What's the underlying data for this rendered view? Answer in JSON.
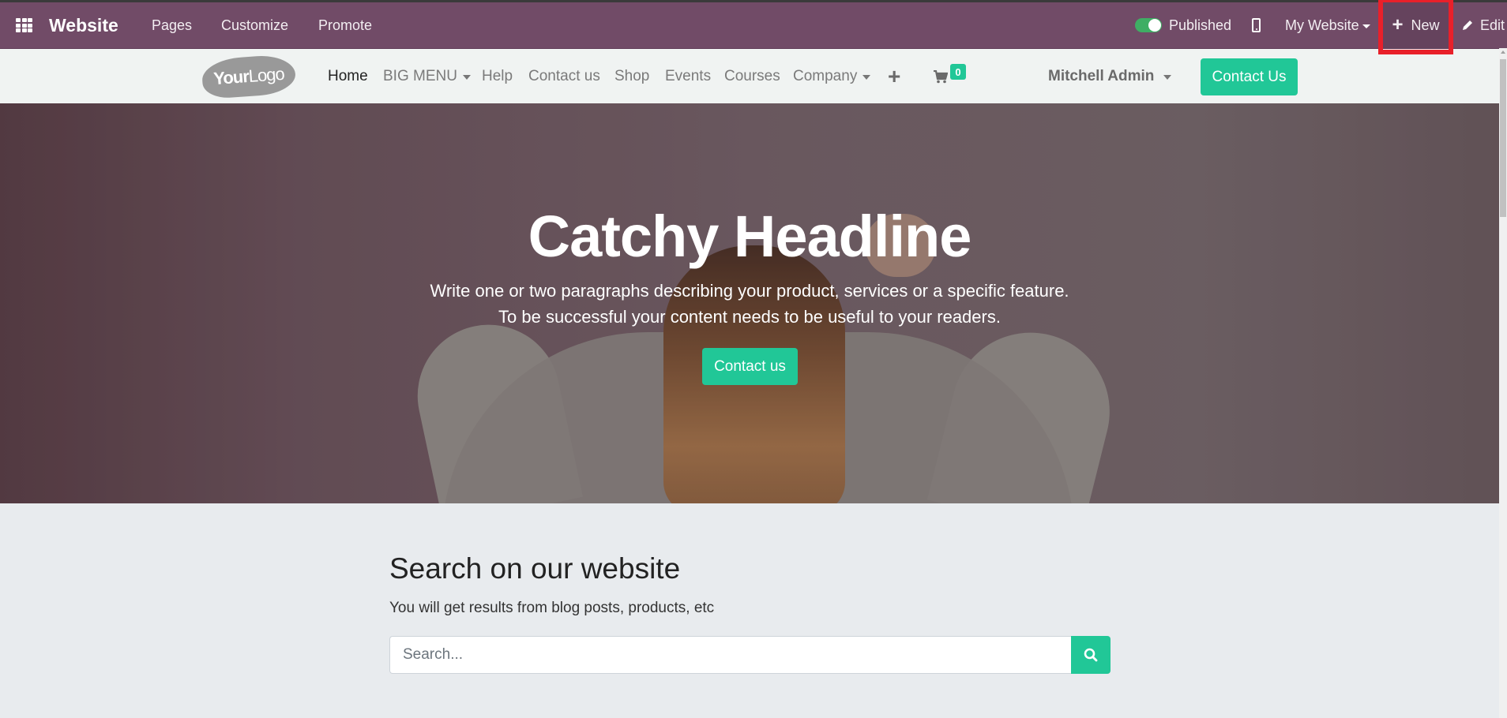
{
  "topbar": {
    "app_icon": "grid-icon",
    "app_name": "Website",
    "menu": [
      "Pages",
      "Customize",
      "Promote"
    ],
    "published_label": "Published",
    "published": true,
    "mobile_preview_icon": "phone-icon",
    "website_selector": "My Website",
    "new_label": "New",
    "edit_label": "Edit",
    "highlight_color": "#e8202a",
    "bar_color": "#714b67"
  },
  "navbar": {
    "logo_bold": "Your",
    "logo_light": "Logo",
    "links": [
      {
        "label": "Home",
        "active": true
      },
      {
        "label": "BIG MENU",
        "dropdown": true
      },
      {
        "label": "Help"
      },
      {
        "label": "Contact us"
      },
      {
        "label": "Shop"
      },
      {
        "label": "Events"
      },
      {
        "label": "Courses"
      },
      {
        "label": "Company",
        "dropdown": true
      }
    ],
    "add_icon": "plus-icon",
    "cart_icon": "cart-icon",
    "cart_count": "0",
    "user_name": "Mitchell Admin",
    "cta_label": "Contact Us",
    "accent_color": "#21c797"
  },
  "hero": {
    "headline": "Catchy Headline",
    "line1": "Write one or two paragraphs describing your product, services or a specific feature.",
    "line2": "To be successful your content needs to be useful to your readers.",
    "button_label": "Contact us"
  },
  "search": {
    "title": "Search on our website",
    "subtitle": "You will get results from blog posts, products, etc",
    "placeholder": "Search...",
    "value": "",
    "button_icon": "search-icon"
  }
}
